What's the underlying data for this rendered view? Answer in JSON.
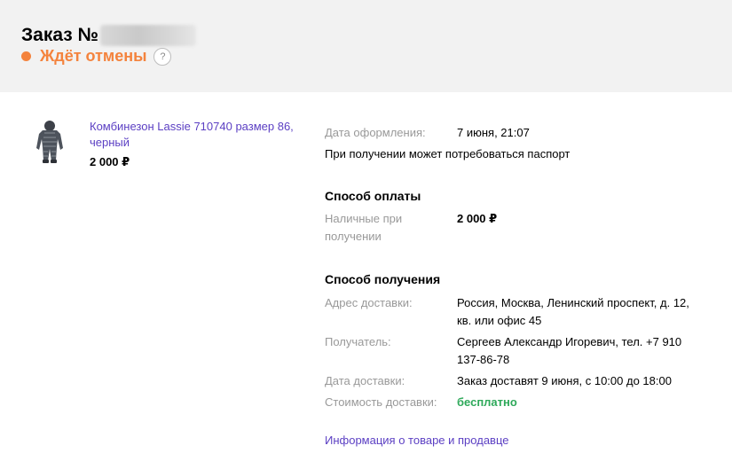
{
  "order": {
    "title": "Заказ №",
    "status": "Ждёт отмены",
    "help_icon": "?"
  },
  "product": {
    "name": "Комбинезон Lassie 710740 размер 86, черный",
    "price": "2 000 ₽",
    "image_icon": "snowsuit-image"
  },
  "details": {
    "order_date_label": "Дата оформления:",
    "order_date_value": "7 июня, 21:07",
    "passport_note": "При получении может потребоваться паспорт",
    "payment_title": "Способ оплаты",
    "payment_method_label": "Наличные при получении",
    "payment_amount": "2 000 ₽",
    "delivery_title": "Способ получения",
    "address_label": "Адрес доставки:",
    "address_value": "Россия, Москва, Ленинский проспект, д. 12, кв. или офис 45",
    "recipient_label": "Получатель:",
    "recipient_value": "Сергеев Александр Игоревич, тел. +7 910 137-86-78",
    "delivery_date_label": "Дата доставки:",
    "delivery_date_value": "Заказ доставят 9 июня, с 10:00 до 18:00",
    "delivery_cost_label": "Стоимость доставки:",
    "delivery_cost_value": "бесплатно",
    "info_link": "Информация о товаре и продавце"
  },
  "colors": {
    "status_orange": "#f4833d",
    "link_purple": "#5b3fc3",
    "free_green": "#2ea95a",
    "header_bg": "#f2f2f2"
  }
}
